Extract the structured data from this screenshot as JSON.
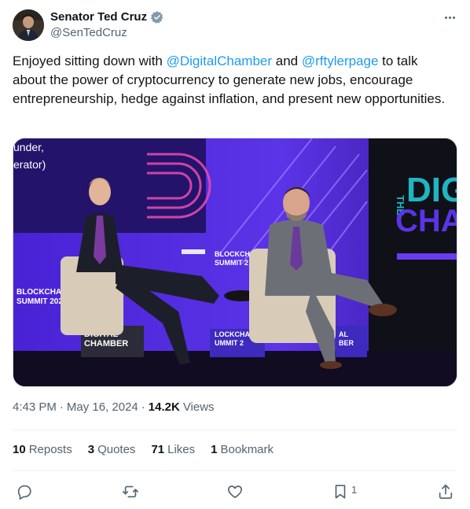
{
  "author": {
    "name": "Senator Ted Cruz",
    "handle": "@SenTedCruz",
    "verified": true,
    "verified_color": "#829aab"
  },
  "tweet": {
    "text_1": "Enjoyed sitting down with ",
    "mention_1": "@DigitalChamber",
    "text_2": " and ",
    "mention_2": "@rftylerpage",
    "text_3": " to talk about the power of cryptocurrency to generate new jobs, encourage entrepreneurship, hedge against inflation, and present new opportunities."
  },
  "media": {
    "stage_text": {
      "top_left_1": "under,",
      "top_left_2": "erator)",
      "blockchain_left_1": "BLOCKCHAI",
      "blockchain_left_2": "SUMMIT 2024",
      "blockchain_center_1": "BLOCKCH",
      "blockchain_center_2": "SUMMIT 2",
      "digital_chamber_1": "DIGITAL",
      "digital_chamber_2": "CHAMBER",
      "podium_1": "LOCKCHAI",
      "podium_2": "UMMIT 2",
      "podium_right_1": "AL",
      "podium_right_2": "BER",
      "screen_the": "THE",
      "screen_big_1": "DIG",
      "screen_big_2": "CHA"
    }
  },
  "meta": {
    "time": "4:43 PM",
    "sep1": "·",
    "date": "May 16, 2024",
    "sep2": "·",
    "views_count": "14.2K",
    "views_label": "Views"
  },
  "stats": {
    "reposts_count": "10",
    "reposts_label": "Reposts",
    "quotes_count": "3",
    "quotes_label": "Quotes",
    "likes_count": "71",
    "likes_label": "Likes",
    "bookmarks_count": "1",
    "bookmarks_label": "Bookmark"
  },
  "actions": {
    "bookmark_count": "1"
  },
  "colors": {
    "link": "#1d9bf0",
    "secondary": "#536471",
    "stage_purple": "#5a2ee0",
    "stage_screen": "#1fb5c2"
  }
}
